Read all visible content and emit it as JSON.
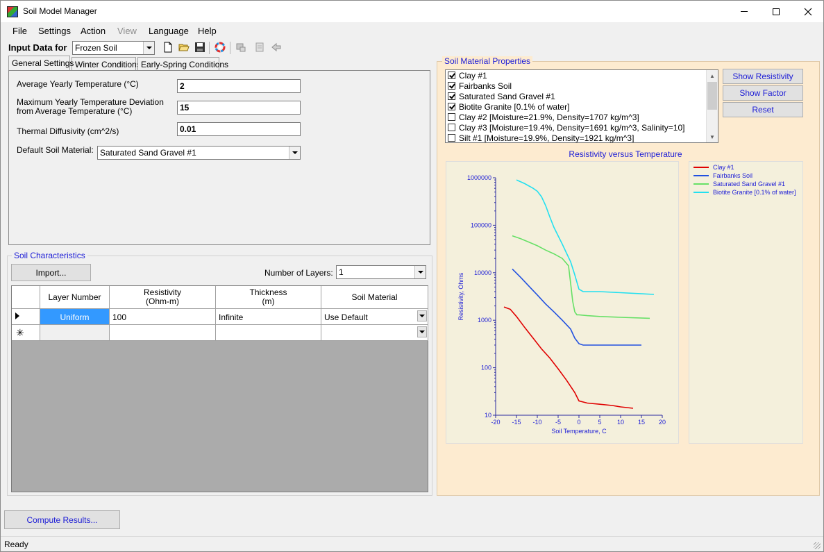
{
  "window": {
    "title": "Soil Model Manager"
  },
  "menu": [
    "File",
    "Settings",
    "Action",
    "View",
    "Language",
    "Help"
  ],
  "toolbar": {
    "label": "Input Data for",
    "mode_value": "Frozen Soil"
  },
  "tabs": [
    "General Settings",
    "Winter Conditions",
    "Early-Spring Conditions"
  ],
  "general": {
    "avg_temp_label": "Average Yearly Temperature (°C)",
    "avg_temp_value": "2",
    "max_dev_label_1": "Maximum Yearly Temperature Deviation",
    "max_dev_label_2": "from Average Temperature (°C)",
    "max_dev_value": "15",
    "diffusivity_label": "Thermal Diffusivity (cm^2/s)",
    "diffusivity_value": "0.01",
    "default_material_label": "Default Soil Material:",
    "default_material_value": "Saturated Sand Gravel #1"
  },
  "soil_characteristics": {
    "title": "Soil Characteristics",
    "import_label": "Import...",
    "layers_label": "Number of Layers:",
    "layers_value": "1",
    "columns": [
      {
        "line1": "Layer Number",
        "line2": ""
      },
      {
        "line1": "Resistivity",
        "line2": "(Ohm-m)"
      },
      {
        "line1": "Thickness",
        "line2": "(m)"
      },
      {
        "line1": "Soil Material",
        "line2": ""
      }
    ],
    "rows": [
      {
        "layer": "Uniform",
        "resistivity": "100",
        "thickness": "Infinite",
        "material": "Use Default"
      }
    ]
  },
  "compute_label": "Compute Results...",
  "status": "Ready",
  "materials": {
    "title": "Soil Material Properties",
    "items": [
      {
        "label": "Clay #1",
        "checked": true
      },
      {
        "label": "Fairbanks Soil",
        "checked": true
      },
      {
        "label": "Saturated Sand Gravel #1",
        "checked": true
      },
      {
        "label": "Biotite Granite [0.1% of water]",
        "checked": true
      },
      {
        "label": "Clay #2 [Moisture=21.9%, Density=1707 kg/m^3]",
        "checked": false
      },
      {
        "label": "Clay  #3 [Moisture=19.4%, Density=1691 kg/m^3, Salinity=10]",
        "checked": false
      },
      {
        "label": "Silt #1 [Moisture=19.9%, Density=1921 kg/m^3]",
        "checked": false
      }
    ],
    "buttons": [
      "Show Resistivity",
      "Show Factor",
      "Reset"
    ]
  },
  "chart_data": {
    "type": "line",
    "title": "Resistivity versus Temperature",
    "xlabel": "Soil Temperature, C",
    "ylabel": "Resistivity, Ohms",
    "xlim": [
      -20,
      20
    ],
    "ylim": [
      10,
      1000000
    ],
    "yscale": "log",
    "xticks": [
      -20,
      -15,
      -10,
      -5,
      0,
      5,
      10,
      15,
      20
    ],
    "yticks": [
      10,
      100,
      1000,
      10000,
      100000,
      1000000
    ],
    "ytick_labels": [
      "10",
      "100",
      "1000",
      "10000",
      "100000",
      "1000000"
    ],
    "legend_position": "right",
    "series": [
      {
        "name": "Clay #1",
        "color": "#e00000",
        "x": [
          -18,
          -16.5,
          -15,
          -13,
          -11,
          -9,
          -7,
          -5,
          -3,
          -1,
          0,
          2,
          5,
          8,
          10,
          13
        ],
        "y": [
          1900,
          1700,
          1200,
          700,
          420,
          250,
          160,
          95,
          55,
          30,
          20,
          18,
          17,
          16,
          15,
          14
        ]
      },
      {
        "name": "Fairbanks Soil",
        "color": "#2050e0",
        "x": [
          -16,
          -14,
          -12,
          -10,
          -8,
          -6,
          -4,
          -2,
          -1,
          0,
          1,
          5,
          10,
          15
        ],
        "y": [
          12000,
          8000,
          5200,
          3400,
          2200,
          1500,
          1000,
          650,
          420,
          320,
          300,
          300,
          300,
          300
        ]
      },
      {
        "name": "Saturated Sand Gravel #1",
        "color": "#66e066",
        "x": [
          -16,
          -14,
          -12,
          -10,
          -8,
          -6,
          -4,
          -2.5,
          -2,
          -1.5,
          -1,
          -0.5,
          0,
          2,
          5,
          10,
          17
        ],
        "y": [
          60000,
          52000,
          44000,
          37000,
          30000,
          25000,
          20000,
          14000,
          6000,
          2500,
          1500,
          1300,
          1300,
          1250,
          1200,
          1150,
          1100
        ]
      },
      {
        "name": "Biotite Granite [0.1% of water]",
        "color": "#22e0f0",
        "x": [
          -15,
          -13,
          -11,
          -10,
          -9,
          -8,
          -7,
          -6,
          -5,
          -4,
          -3,
          -2,
          -1,
          0,
          1,
          5,
          10,
          15,
          18
        ],
        "y": [
          900000,
          750000,
          600000,
          520000,
          400000,
          260000,
          150000,
          90000,
          60000,
          40000,
          26000,
          17000,
          9000,
          4500,
          4000,
          4000,
          3800,
          3600,
          3500
        ]
      }
    ]
  }
}
